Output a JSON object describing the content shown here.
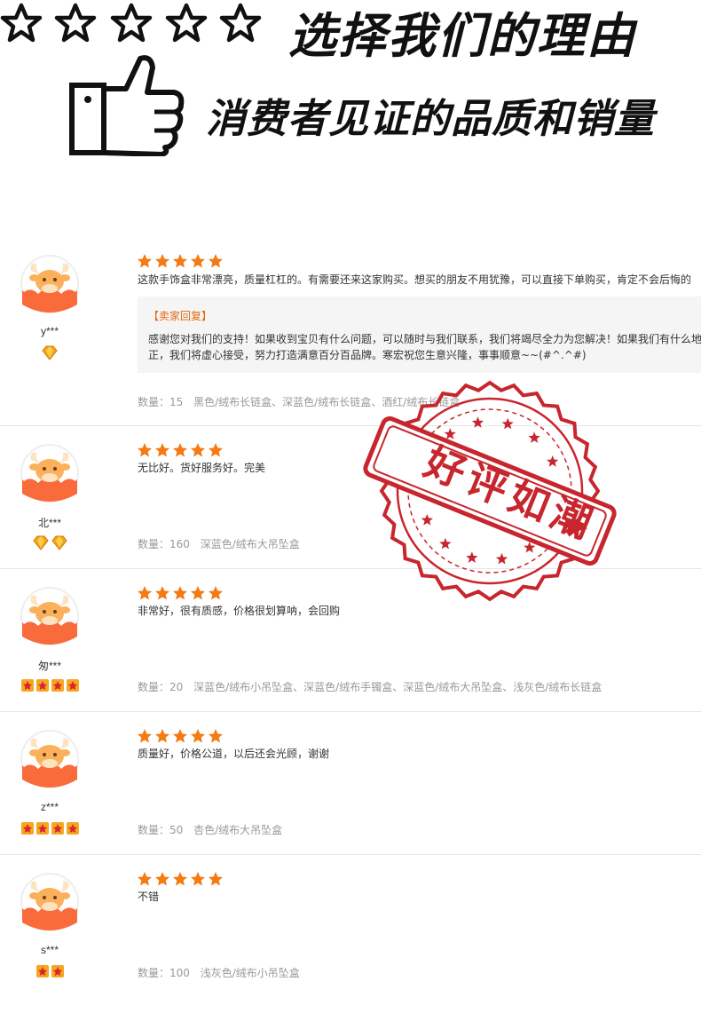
{
  "header": {
    "headline": "选择我们的理由",
    "subline": "消费者见证的品质和销量",
    "outline_star_count": 5,
    "icons": [
      "outline-star-icon",
      "thumbs-up-icon"
    ]
  },
  "colors": {
    "rating_star": "#f47a14",
    "reply_title": "#e4680f",
    "meta_text": "#999999",
    "stamp_red": "#c8262e",
    "avatar_orange": "#f96b3a"
  },
  "reviews": [
    {
      "user": "y***",
      "badge_type": "diamond",
      "badge_count": 1,
      "rating": 5,
      "content": "这款手饰盒非常漂亮，质量杠杠的。有需要还来这家购买。想买的朋友不用犹豫，可以直接下单购买，肯定不会后悔的",
      "reply": {
        "title": "【卖家回复】",
        "text": "感谢您对我们的支持！如果收到宝贝有什么问题，可以随时与我们联系，我们将竭尽全力为您解决！如果我们有什么地方做得不好，欢迎指正，我们将虚心接受，努力打造满意百分百品牌。寒宏祝您生意兴隆，事事顺意~~(#^.^#)",
        "line1": "感谢您对我们的支持！如果收到宝贝有什么问题，可以随时与我们联系，我们将竭尽全力为您解决！如果我们有什么地",
        "line2": "正，我们将虚心接受，努力打造满意百分百品牌。寒宏祝您生意兴隆，事事顺意~~(#^.^#)"
      },
      "quantity": "数量：15",
      "sku": "黑色/绒布长链盒、深蓝色/绒布长链盒、酒红/绒布长链盒"
    },
    {
      "user": "北***",
      "badge_type": "diamond",
      "badge_count": 2,
      "rating": 5,
      "content": "无比好。货好服务好。完美",
      "quantity": "数量：160",
      "sku": "深蓝色/绒布大吊坠盒"
    },
    {
      "user": "匆***",
      "badge_type": "crown",
      "badge_count": 4,
      "rating": 5,
      "content": "非常好，很有质感，价格很划算呐，会回购",
      "quantity": "数量：20",
      "sku": "深蓝色/绒布小吊坠盒、深蓝色/绒布手镯盒、深蓝色/绒布大吊坠盒、浅灰色/绒布长链盒"
    },
    {
      "user": "z***",
      "badge_type": "crown",
      "badge_count": 4,
      "rating": 5,
      "content": "质量好，价格公道，以后还会光顾，谢谢",
      "quantity": "数量：50",
      "sku": "杏色/绒布大吊坠盒"
    },
    {
      "user": "s***",
      "badge_type": "crown",
      "badge_count": 2,
      "rating": 5,
      "content": "不错",
      "quantity": "数量：100",
      "sku": "浅灰色/绒布小吊坠盒"
    }
  ],
  "stamp": {
    "text": "好评如潮",
    "icon": "star-icon"
  }
}
